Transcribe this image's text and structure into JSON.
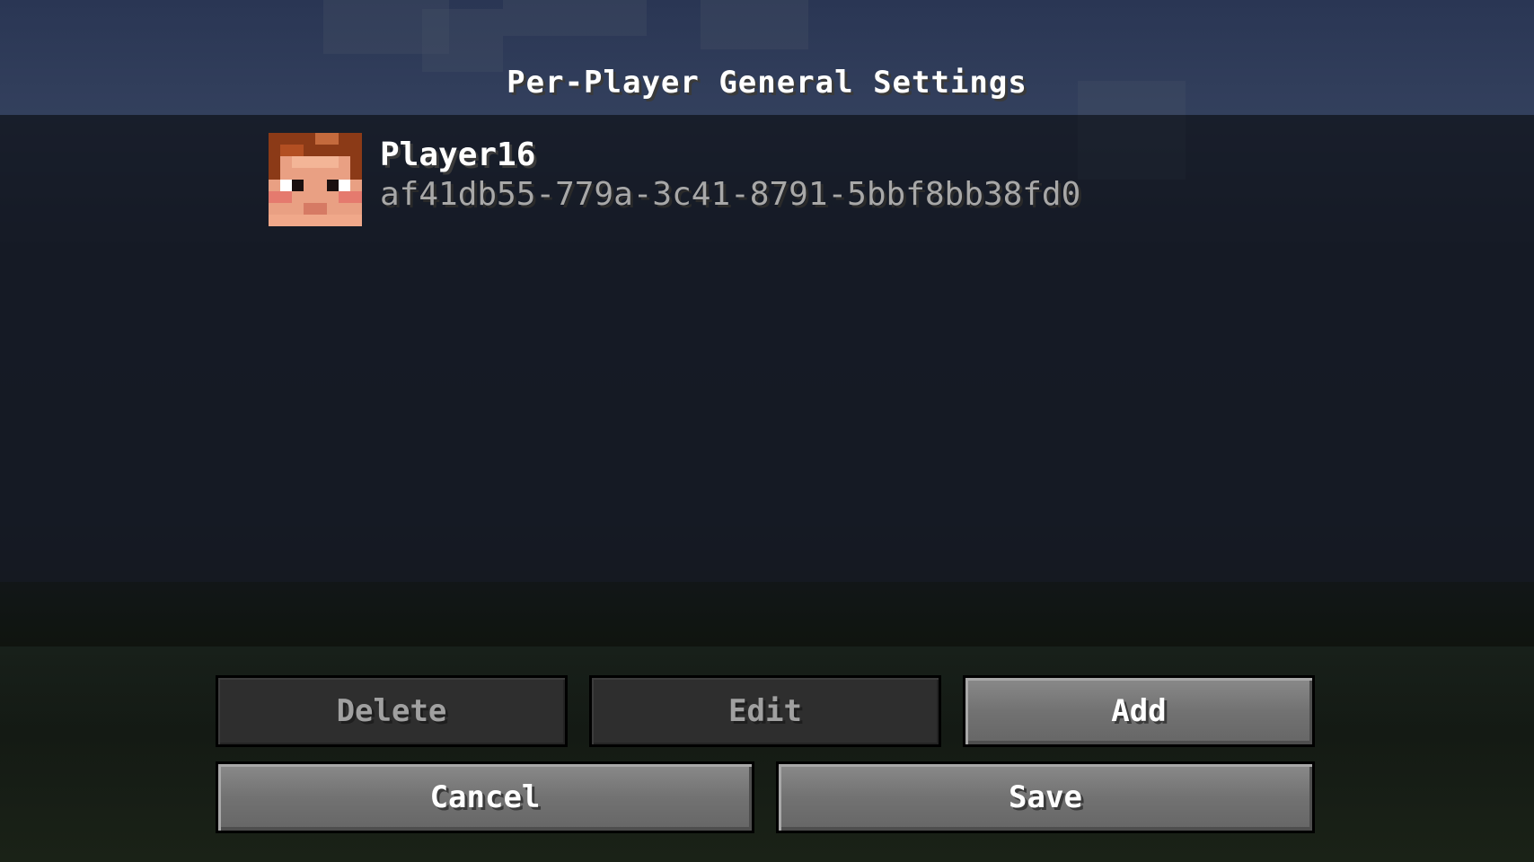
{
  "screen": {
    "title": "Per-Player General Settings"
  },
  "players": [
    {
      "name": "Player16",
      "uuid": "af41db55-779a-3c41-8791-5bbf8bb38fd0"
    }
  ],
  "buttons": {
    "delete": "Delete",
    "edit": "Edit",
    "add": "Add",
    "cancel": "Cancel",
    "save": "Save"
  },
  "colors": {
    "active_button": "#727272",
    "disabled_button": "#2e2e2e",
    "disabled_text": "#a0a0a0",
    "uuid_text": "#a8a8a8"
  }
}
